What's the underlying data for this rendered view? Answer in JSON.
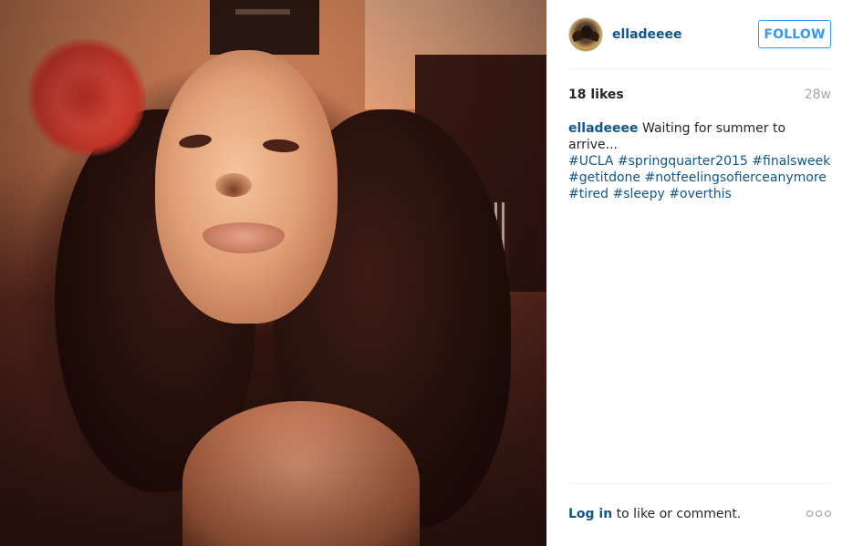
{
  "post": {
    "username": "elladeeee",
    "follow_label": "FOLLOW",
    "likes": "18 likes",
    "age": "28w",
    "caption": {
      "username": "elladeeee",
      "text": "Waiting for summer to arrive...",
      "hashtags": [
        "#UCLA",
        "#springquarter2015",
        "#finalsweek",
        "#getitdone",
        "#notfeelingsofierceanymore",
        "#tired",
        "#sleepy",
        "#overthis"
      ]
    },
    "footer": {
      "login_link": "Log in",
      "login_text": "to like or comment."
    }
  },
  "colors": {
    "link_blue": "#125688",
    "follow_blue": "#3897f0",
    "muted_gray": "#a5a7aa",
    "divider": "#efefef"
  },
  "icons": {
    "more": "more-options-icon"
  }
}
